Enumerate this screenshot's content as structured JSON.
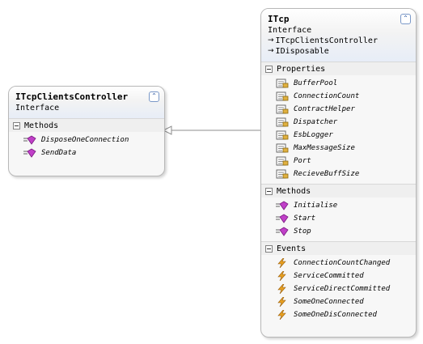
{
  "diagram": {
    "itcp": {
      "title": "ITcp",
      "kind": "Interface",
      "inherits": [
        "ITcpClientsController",
        "IDisposable"
      ],
      "sections": {
        "properties": {
          "label": "Properties",
          "items": [
            "BufferPool",
            "ConnectionCount",
            "ContractHelper",
            "Dispatcher",
            "EsbLogger",
            "MaxMessageSize",
            "Port",
            "RecieveBuffSize"
          ]
        },
        "methods": {
          "label": "Methods",
          "items": [
            "Initialise",
            "Start",
            "Stop"
          ]
        },
        "events": {
          "label": "Events",
          "items": [
            "ConnectionCountChanged",
            "ServiceCommitted",
            "ServiceDirectCommitted",
            "SomeOneConnected",
            "SomeOneDisConnected"
          ]
        }
      }
    },
    "itcp_clients_controller": {
      "title": "ITcpClientsController",
      "kind": "Interface",
      "sections": {
        "methods": {
          "label": "Methods",
          "items": [
            "DisposeOneConnection",
            "SendData"
          ]
        }
      }
    },
    "icons": {
      "property": "property-icon",
      "method": "method-icon",
      "event": "event-icon",
      "collapse": "double-chevron-up-icon",
      "inherit_arrow": "arrow-right-icon"
    },
    "colors": {
      "header_gradient_end": "#e7edf7",
      "connector": "#8c8c8c",
      "method_icon": "#c040c8",
      "event_icon": "#e8a020"
    }
  }
}
